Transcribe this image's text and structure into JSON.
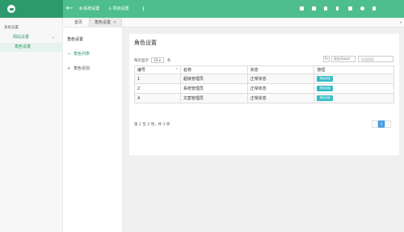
{
  "header": {
    "tabs": [
      {
        "label": "系统设置",
        "icon": "gear-icon"
      },
      {
        "label": "项目设置",
        "icon": "user-icon"
      }
    ],
    "more": "⋮",
    "tools": [
      "bell-icon",
      "list-icon",
      "copy-icon",
      "mobile-icon",
      "lock-icon",
      "user-icon",
      "expand-icon"
    ]
  },
  "page_tabs": {
    "home": "首页",
    "active": "角色设置",
    "close": "×",
    "dropdown": "▾"
  },
  "sidebar": {
    "title": "系统设置",
    "group": "网站设置",
    "group_chevron": "⌄",
    "item": "角色设置"
  },
  "subnav": {
    "title": "角色设置",
    "items": [
      {
        "icon": "—",
        "label": "角色列表"
      },
      {
        "icon": "+",
        "label": "角色添加"
      }
    ]
  },
  "main": {
    "title": "角色设置",
    "length": {
      "prefix": "每页显示",
      "value": "10",
      "suffix": "条"
    },
    "refresh": "↻",
    "export": "导出 Excel",
    "search_placeholder": "快速搜索",
    "columns": [
      "编号",
      "名称",
      "状态",
      "按钮"
    ],
    "sort_icon": "▾",
    "rows": [
      {
        "id": "1",
        "name": "超级管理员",
        "status": "正常状态",
        "action": "角色添加"
      },
      {
        "id": "2",
        "name": "系统管理员",
        "status": "正常状态",
        "action": "角色添加"
      },
      {
        "id": "4",
        "name": "文案管理员",
        "status": "正常状态",
        "action": "角色添加"
      }
    ],
    "summary": "第 1 至 3 项，共 3 项",
    "pager": {
      "prev": "‹",
      "current": "1",
      "next": "›"
    }
  },
  "colors": {
    "header_dark": "#2e9a6c",
    "header_light": "#4fbe8f",
    "accent": "#2e9a6c",
    "button": "#35bcc6",
    "pager_active": "#4a9fe0"
  }
}
